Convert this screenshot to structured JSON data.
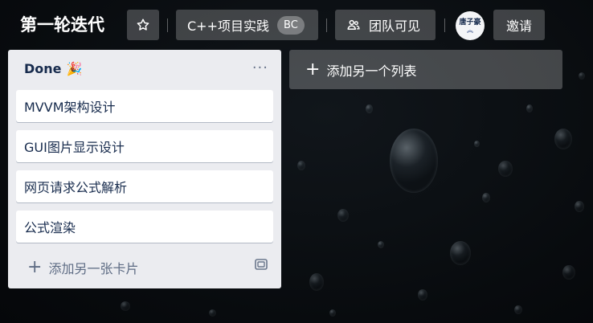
{
  "header": {
    "board_title": "第一轮迭代",
    "team_name": "C++项目实践",
    "team_badge": "BC",
    "visibility_label": "团队可见",
    "avatar_text": "唐子豪",
    "invite_label": "邀请",
    "icons": {
      "star": "star-icon",
      "visibility": "team-visibility-icon",
      "avatar_chevron": "chevron-up-icon"
    }
  },
  "list": {
    "title": "Done",
    "title_emoji": "🎉",
    "menu_label": "···",
    "cards": [
      {
        "title": "MVVM架构设计"
      },
      {
        "title": "GUI图片显示设计"
      },
      {
        "title": "网页请求公式解析"
      },
      {
        "title": "公式渲染"
      }
    ],
    "add_card_label": "添加另一张卡片"
  },
  "add_list_label": "添加另一个列表",
  "colors": {
    "list_bg": "#ebecf0",
    "card_bg": "#ffffff",
    "text": "#172b4d",
    "subtle": "#5e6c84"
  }
}
